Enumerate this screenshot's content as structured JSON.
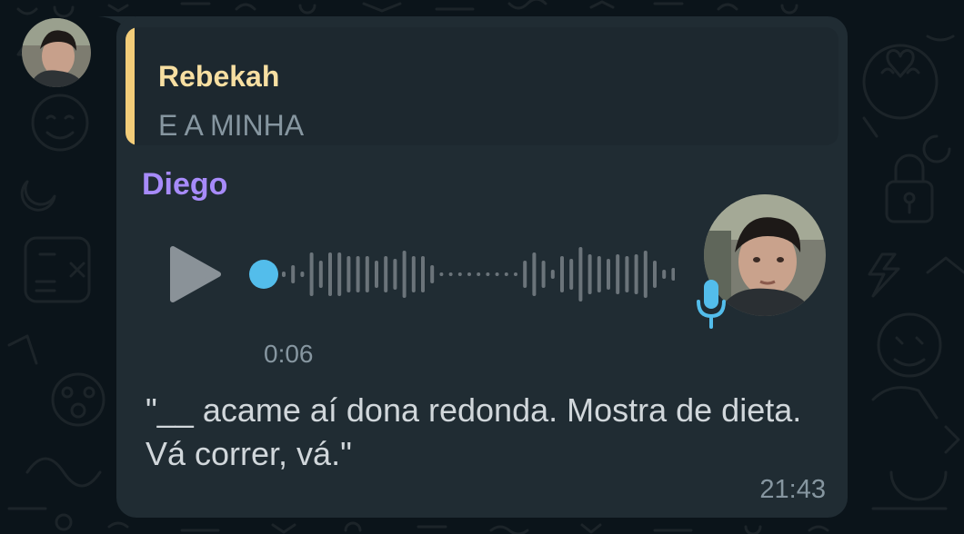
{
  "sender": {
    "avatar_icon": "profile-photo"
  },
  "reply": {
    "author": "Rebekah",
    "text": "E A MINHA",
    "bar_color": "#f3cd79"
  },
  "message": {
    "author": "Diego",
    "author_color": "#a78bfa",
    "voice_note": {
      "play_icon": "play-icon",
      "duration": "0:06",
      "progress": 0,
      "accent_color": "#53bdeb",
      "mic_icon": "microphone-icon",
      "avatar_icon": "profile-photo"
    },
    "transcript": "\"__ acame aí dona redonda. Mostra de dieta. Vá correr, vá.\"",
    "timestamp": "21:43"
  },
  "colors": {
    "bubble": "#202c33",
    "background": "#0b141a"
  }
}
